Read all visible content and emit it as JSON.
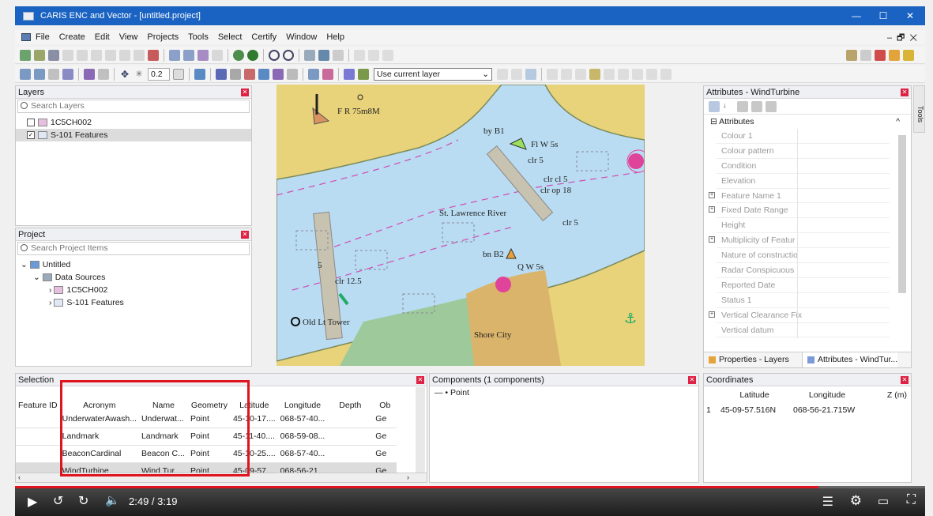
{
  "window": {
    "title": "CARIS ENC and Vector - [untitled.project]"
  },
  "menu": [
    "File",
    "Create",
    "Edit",
    "View",
    "Projects",
    "Tools",
    "Select",
    "Certify",
    "Window",
    "Help"
  ],
  "toolbar": {
    "zoom_value": "0.2",
    "layer_select": "Use current layer"
  },
  "layers": {
    "title": "Layers",
    "search_placeholder": "Search Layers",
    "items": [
      {
        "label": "1C5CH002"
      },
      {
        "label": "S-101 Features"
      }
    ]
  },
  "project": {
    "title": "Project",
    "search_placeholder": "Search Project Items",
    "items": [
      {
        "label": "Untitled"
      },
      {
        "label": "Data Sources"
      },
      {
        "label": "1C5CH002"
      },
      {
        "label": "S-101 Features"
      }
    ]
  },
  "map": {
    "labels": [
      "F R 75m8M",
      "by B1",
      "Fl W 5s",
      "clr 5",
      "clr cl 5",
      "clr op 18",
      "St. Lawrence River",
      "clr 5",
      "bn B2",
      "Q W 5s",
      "clr 12.5",
      "Old Lt Tower",
      "Shore City",
      "5"
    ]
  },
  "attributes": {
    "title": "Attributes - WindTurbine",
    "section": "Attributes",
    "rows": [
      {
        "label": "Colour 1"
      },
      {
        "label": "Colour pattern"
      },
      {
        "label": "Condition"
      },
      {
        "label": "Elevation"
      },
      {
        "label": "Feature Name 1"
      },
      {
        "label": "Fixed Date Range"
      },
      {
        "label": "Height"
      },
      {
        "label": "Multiplicity of Featur"
      },
      {
        "label": "Nature of constructio"
      },
      {
        "label": "Radar Conspicuous"
      },
      {
        "label": "Reported Date"
      },
      {
        "label": "Status 1"
      },
      {
        "label": "Vertical Clearance Fix"
      },
      {
        "label": "Vertical datum"
      }
    ],
    "tabs": [
      "Properties - Layers",
      "Attributes - WindTur..."
    ],
    "side_tab": "Tools"
  },
  "selection": {
    "title": "Selection",
    "columns": [
      "Feature ID",
      "Acronym",
      "Name",
      "Geometry",
      "Latitude",
      "Longitude",
      "Depth",
      "Ob"
    ],
    "rows": [
      {
        "id": "",
        "acronym": "UnderwaterAwash...",
        "name": "Underwat...",
        "geometry": "Point",
        "lat": "45-10-17....",
        "lon": "068-57-40...",
        "depth": "",
        "ob": "Ge"
      },
      {
        "id": "",
        "acronym": "Landmark",
        "name": "Landmark",
        "geometry": "Point",
        "lat": "45-11-40....",
        "lon": "068-59-08...",
        "depth": "",
        "ob": "Ge"
      },
      {
        "id": "",
        "acronym": "BeaconCardinal",
        "name": "Beacon C...",
        "geometry": "Point",
        "lat": "45-10-25....",
        "lon": "068-57-40...",
        "depth": "",
        "ob": "Ge"
      },
      {
        "id": "",
        "acronym": "WindTurbine",
        "name": "Wind Tur...",
        "geometry": "Point",
        "lat": "45-09-57....",
        "lon": "068-56-21...",
        "depth": "",
        "ob": "Ge"
      }
    ],
    "highlight_color": "#e0141e"
  },
  "components": {
    "title": "Components (1 components)",
    "item": "Point"
  },
  "coordinates": {
    "title": "Coordinates",
    "columns": [
      "Latitude",
      "Longitude",
      "Z (m)"
    ],
    "row": {
      "index": "1",
      "lat": "45-09-57.516N",
      "lon": "068-56-21.715W",
      "z": ""
    }
  },
  "player": {
    "time": "2:49 / 3:19",
    "progress": 0.883
  },
  "colors": {
    "titlebar": "#1a63c2",
    "water": "#b9dcf2",
    "land": "#e8d27a",
    "highlight": "#e0141e"
  }
}
